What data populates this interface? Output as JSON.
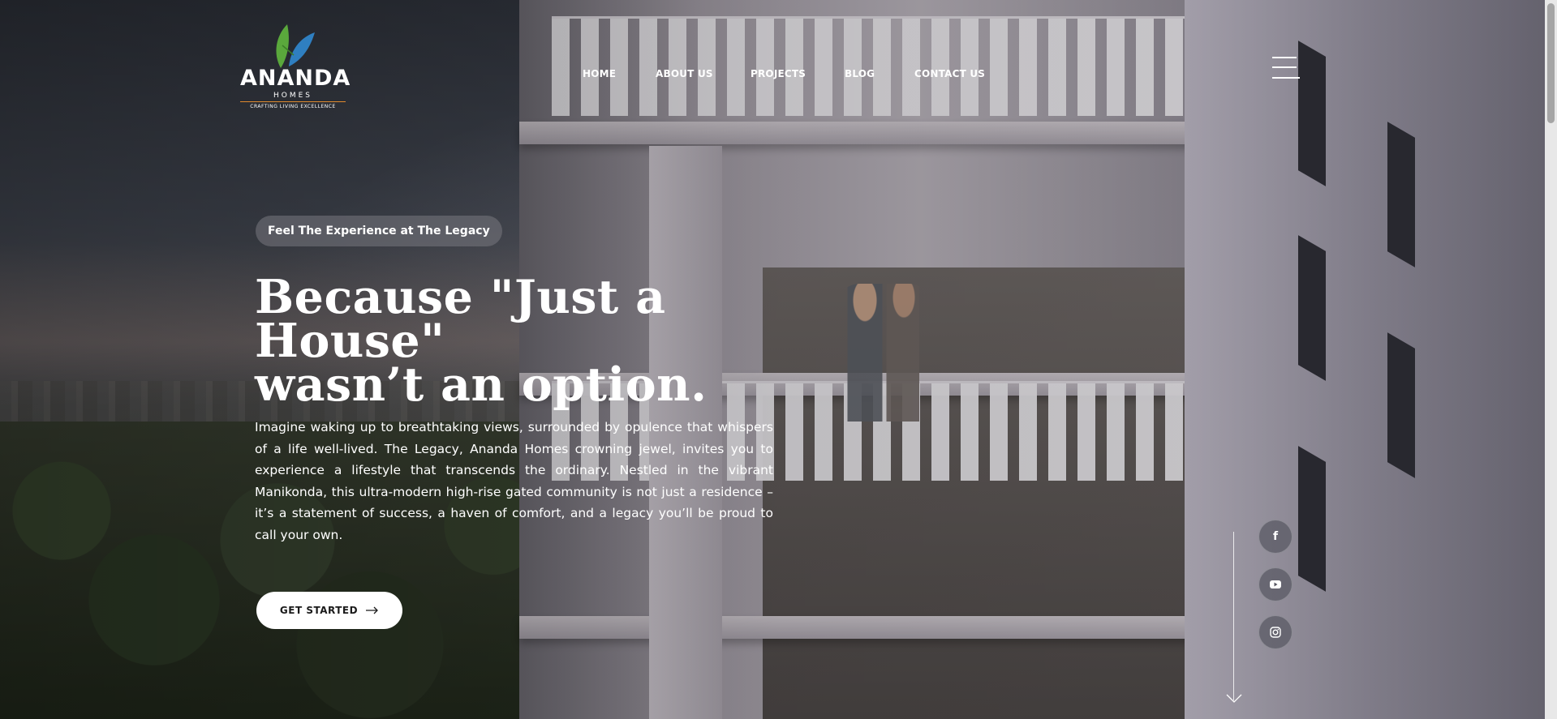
{
  "brand": {
    "name": "ANANDA",
    "sub": "HOMES",
    "tagline": "CRAFTING LIVING EXCELLENCE",
    "colors": {
      "leaf_green": "#5aa83c",
      "leaf_blue": "#2f7fc1",
      "underline_orange": "#e08a2e"
    }
  },
  "nav": {
    "items": [
      {
        "label": "HOME"
      },
      {
        "label": "ABOUT US"
      },
      {
        "label": "PROJECTS"
      },
      {
        "label": "BLOG"
      },
      {
        "label": "CONTACT US"
      }
    ],
    "menu_icon": "hamburger-menu-icon"
  },
  "hero": {
    "eyebrow": "Feel The Experience at The Legacy",
    "headline_line1": "Because \"Just a House\"",
    "headline_line2": "wasn’t an option.",
    "body": "Imagine waking up to breathtaking views, surrounded by opulence that whispers of a life well-lived. The Legacy, Ananda Homes crowning jewel, invites you to experience a lifestyle that transcends the ordinary. Nestled in the vibrant Manikonda, this ultra-modern high-rise gated community is not just a residence – it’s a statement of success, a haven of comfort, and a legacy you’ll be proud to call your own.",
    "cta_label": "GET STARTED",
    "cta_icon": "arrow-right-icon"
  },
  "social": [
    {
      "name": "facebook-icon",
      "glyph": "f"
    },
    {
      "name": "youtube-icon",
      "glyph": "▶"
    },
    {
      "name": "instagram-icon",
      "glyph": "◎"
    }
  ],
  "scroll_indicator_icon": "scroll-down-arrow-icon"
}
